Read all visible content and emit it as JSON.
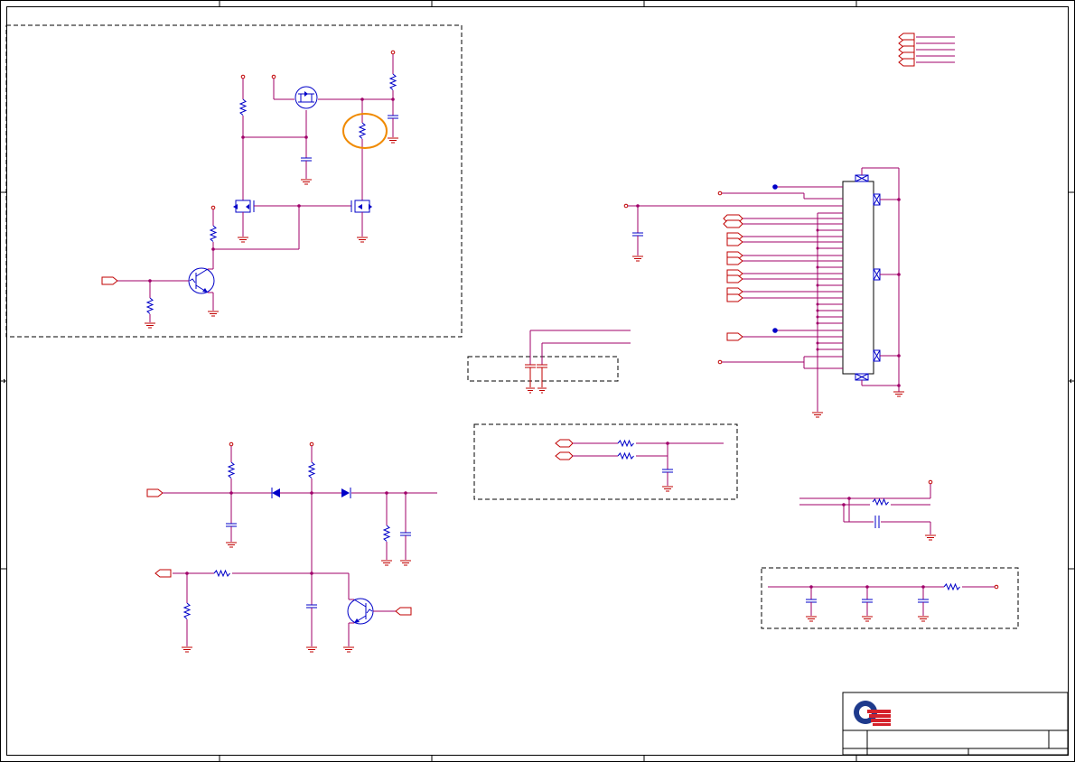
{
  "colors": {
    "annotation": "#f08a00"
  }
}
